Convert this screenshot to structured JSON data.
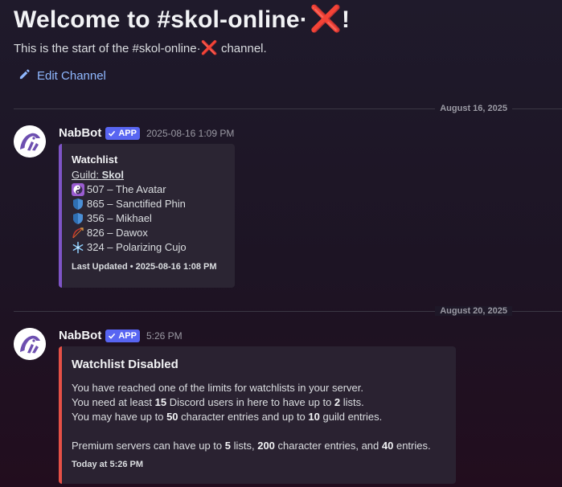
{
  "welcome": {
    "title_prefix": "Welcome to #skol-online·",
    "title_mark": "❌",
    "title_suffix": "!",
    "subtitle_prefix": "This is the start of the #skol-online·",
    "subtitle_mark": "❌",
    "subtitle_suffix": " channel.",
    "edit_label": "Edit Channel"
  },
  "dividers": [
    "August 16, 2025",
    "August 20, 2025"
  ],
  "messages": [
    {
      "author": "NabBot",
      "badge": "APP",
      "timestamp": "2025-08-16 1:09 PM",
      "embed": {
        "title": "Watchlist",
        "guild_label": "Guild: ",
        "guild_name": "Skol",
        "entries": [
          {
            "icon": "yin-yang-icon",
            "text": "507 – The Avatar"
          },
          {
            "icon": "shield-icon",
            "text": "865 – Sanctified Phin"
          },
          {
            "icon": "shield-icon",
            "text": "356 – Mikhael"
          },
          {
            "icon": "bow-icon",
            "text": "826 – Dawox"
          },
          {
            "icon": "snowflake-icon",
            "text": "324 – Polarizing Cujo"
          }
        ],
        "footer": "Last Updated • 2025-08-16 1:08 PM"
      }
    },
    {
      "author": "NabBot",
      "badge": "APP",
      "timestamp": "5:26 PM",
      "embed": {
        "title": "Watchlist Disabled",
        "line1": "You have reached one of the limits for watchlists in your server.",
        "line2": {
          "a": "You need at least ",
          "b": "15",
          "c": " Discord users in here to have up to ",
          "d": "2",
          "e": " lists."
        },
        "line3": {
          "a": "You may have up to ",
          "b": "50",
          "c": " character entries and up to ",
          "d": "10",
          "e": " guild entries."
        },
        "line4": {
          "a": "Premium servers can have up to ",
          "b": "5",
          "c": " lists, ",
          "d": "200",
          "e": " character entries, and ",
          "f": "40",
          "g": " entries."
        },
        "footer": "Today at 5:26 PM"
      }
    }
  ]
}
